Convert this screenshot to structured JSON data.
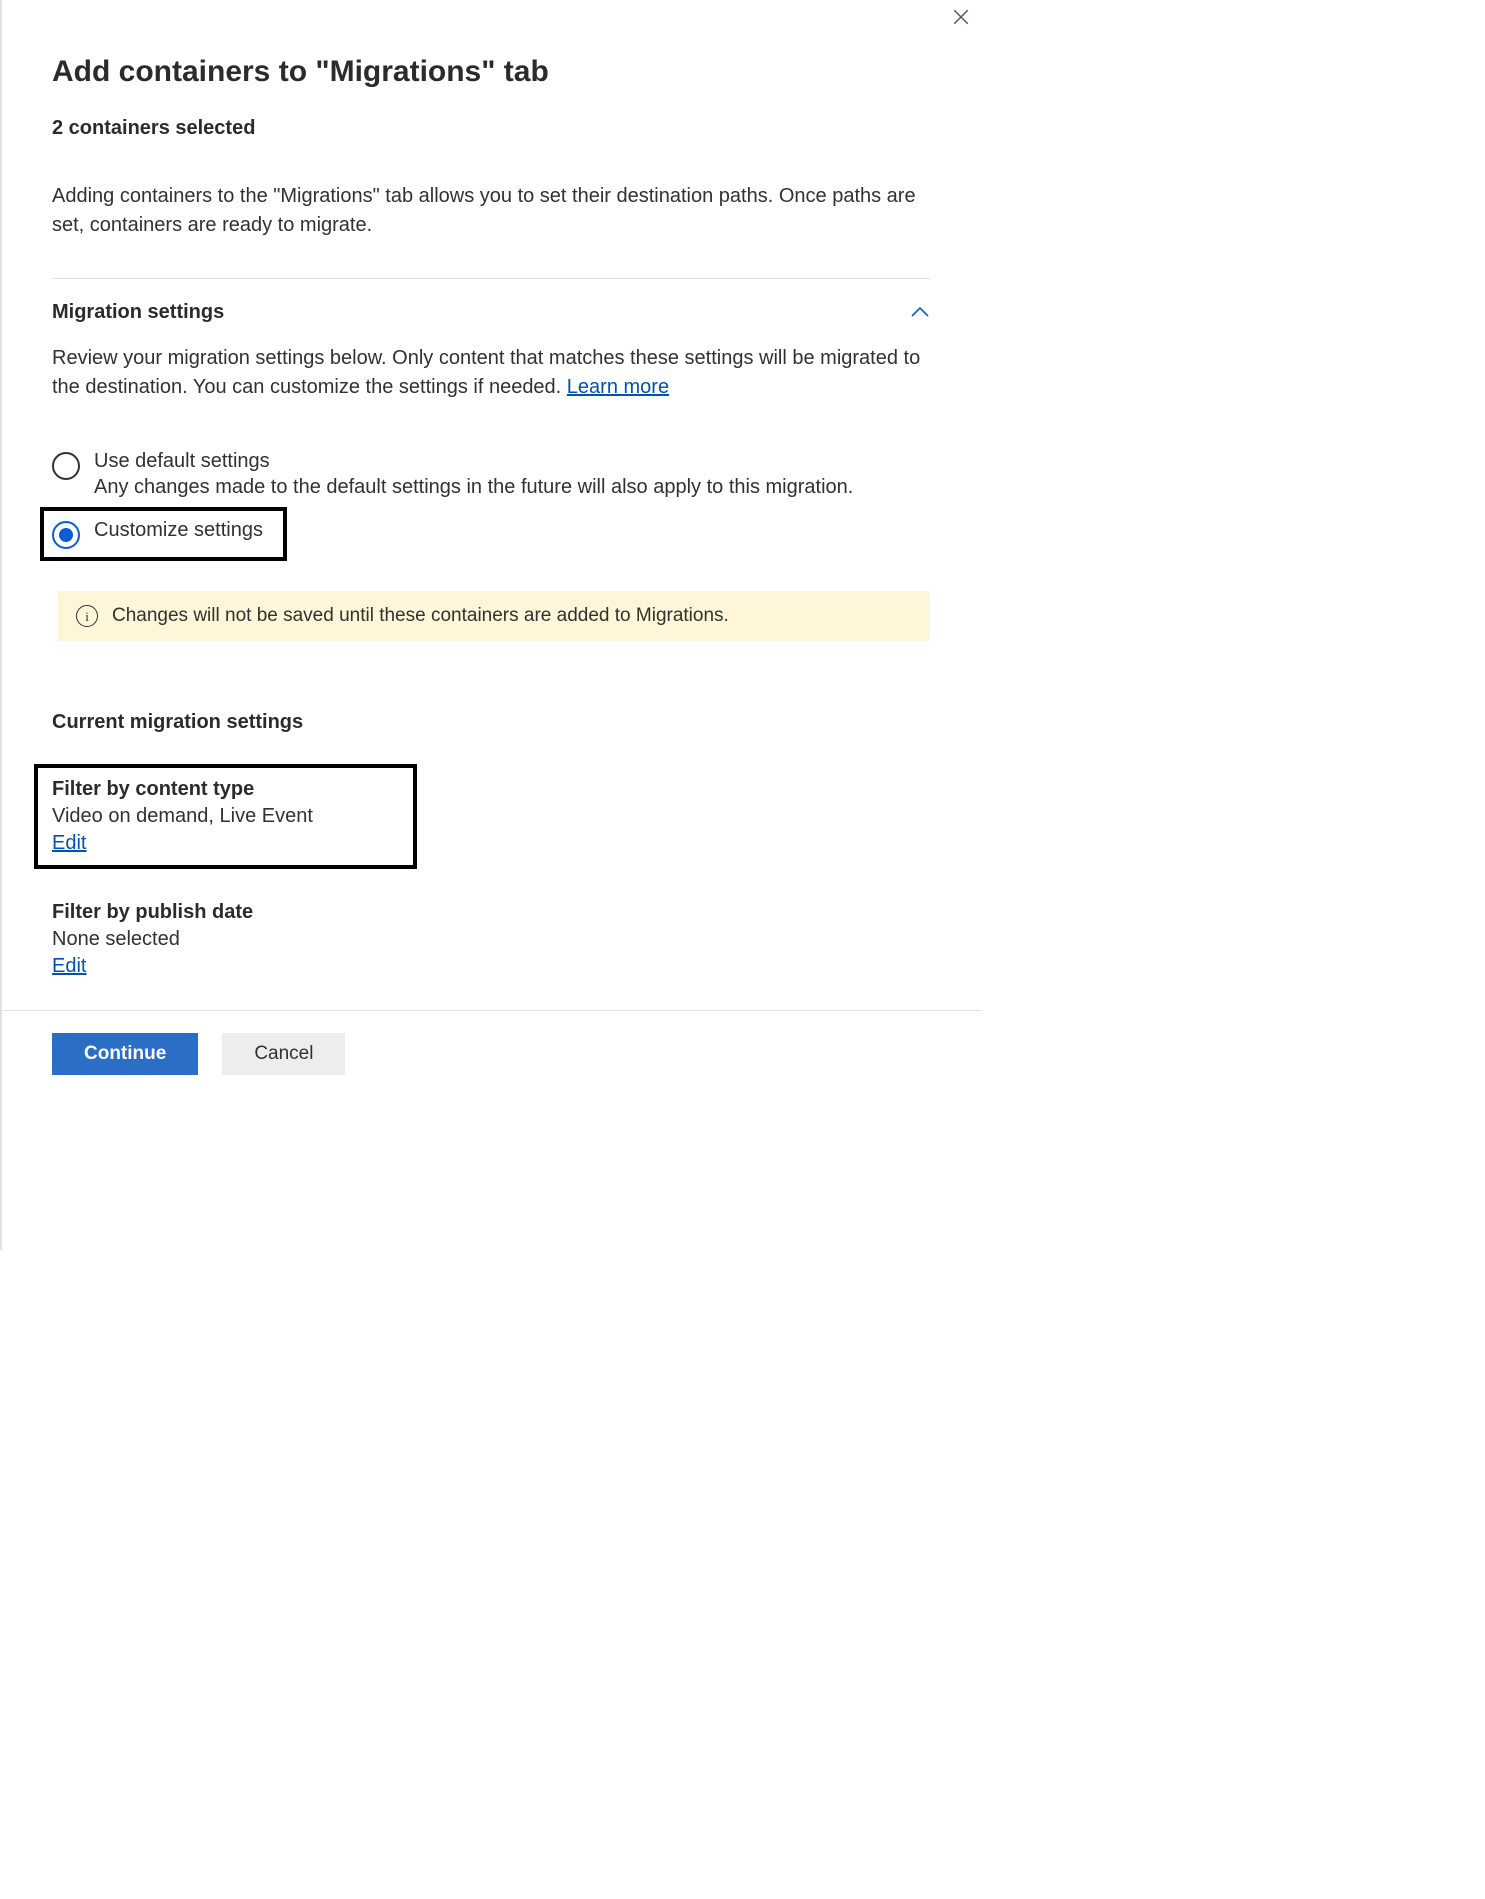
{
  "header": {
    "title": "Add containers to \"Migrations\" tab",
    "subheading": "2 containers selected",
    "description": "Adding containers to the \"Migrations\" tab allows you to set their destination paths. Once paths are set, containers are ready to migrate."
  },
  "migration_settings": {
    "title": "Migration settings",
    "description_before_link": "Review your migration settings below. Only content that matches these settings will be migrated to the destination. You can customize the settings if needed. ",
    "learn_more": "Learn more",
    "radio_default": {
      "label": "Use default settings",
      "subtext": "Any changes made to the default settings in the future will also apply to this migration."
    },
    "radio_customize": {
      "label": "Customize settings"
    },
    "info_banner": "Changes will not be saved until these containers are added to Migrations."
  },
  "current_settings": {
    "heading": "Current migration settings",
    "filter_content_type": {
      "title": "Filter by content type",
      "value": "Video on demand, Live Event",
      "edit": "Edit"
    },
    "filter_publish_date": {
      "title": "Filter by publish date",
      "value": "None selected",
      "edit": "Edit"
    }
  },
  "footer": {
    "continue": "Continue",
    "cancel": "Cancel"
  }
}
